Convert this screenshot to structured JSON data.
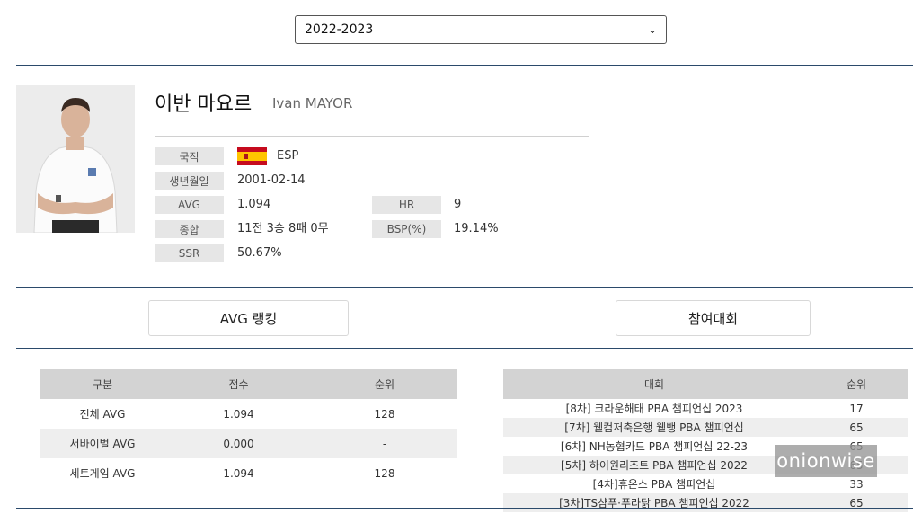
{
  "season": {
    "selected": "2022-2023"
  },
  "player": {
    "name_ko": "이반 마요르",
    "name_en": "Ivan MAYOR",
    "labels": {
      "nationality": "국적",
      "birth": "생년월일",
      "avg": "AVG",
      "hr": "HR",
      "record": "종합",
      "bsp": "BSP(%)",
      "ssr": "SSR"
    },
    "values": {
      "nationality": "ESP",
      "birth": "2001-02-14",
      "avg": "1.094",
      "hr": "9",
      "record": "11전 3승 8패 0무",
      "bsp": "19.14%",
      "ssr": "50.67%"
    }
  },
  "tabs": {
    "avg_rank": "AVG 랭킹",
    "tournaments": "참여대회"
  },
  "avg_table": {
    "headers": [
      "구분",
      "점수",
      "순위"
    ],
    "rows": [
      {
        "cat": "전체 AVG",
        "score": "1.094",
        "rank": "128"
      },
      {
        "cat": "서바이벌 AVG",
        "score": "0.000",
        "rank": "-"
      },
      {
        "cat": "세트게임 AVG",
        "score": "1.094",
        "rank": "128"
      }
    ]
  },
  "tournament_table": {
    "headers": [
      "대회",
      "순위"
    ],
    "rows": [
      {
        "name": "[8차] 크라운해태 PBA 챔피언십 2023",
        "rank": "17"
      },
      {
        "name": "[7차] 웰컴저축은행 웰뱅 PBA 챔피언십",
        "rank": "65"
      },
      {
        "name": "[6차] NH농협카드 PBA 챔피언십 22-23",
        "rank": "65"
      },
      {
        "name": "[5차] 하이원리조트 PBA 챔피언십 2022",
        "rank": "65"
      },
      {
        "name": "[4차]휴온스 PBA 챔피언십",
        "rank": "33"
      },
      {
        "name": "[3차]TS샴푸·푸라닭 PBA 챔피언십 2022",
        "rank": "65"
      }
    ]
  },
  "watermark": "onionwise",
  "colors": {
    "divider": "#2b4a6b",
    "label_bg": "#e6e6e6",
    "header_bg": "#d3d3d3"
  }
}
